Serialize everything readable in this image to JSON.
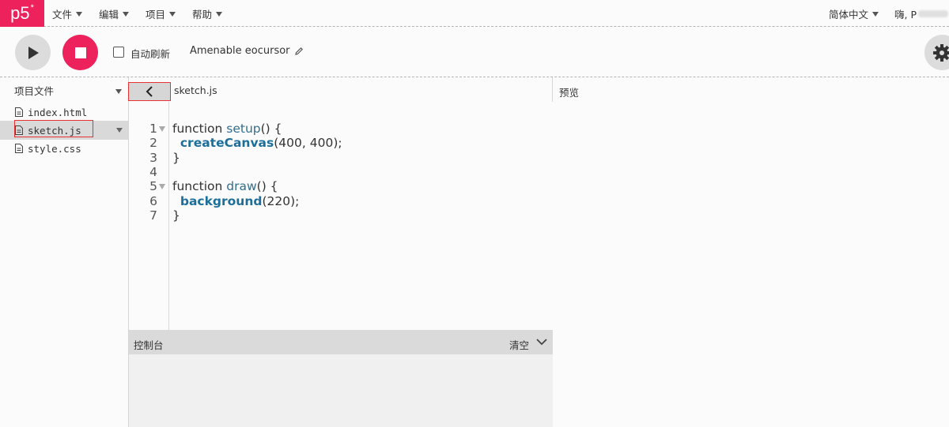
{
  "nav": {
    "logo": "p5",
    "logo_mark": "*",
    "menus": [
      "文件",
      "编辑",
      "项目",
      "帮助"
    ],
    "language": "简体中文",
    "user_greeting": "嗨, P"
  },
  "toolbar": {
    "play_icon": "play-icon",
    "stop_icon": "stop-icon",
    "autorefresh_label": "自动刷新",
    "autorefresh_checked": false,
    "project_name": "Amenable eocursor",
    "settings_icon": "gear-icon"
  },
  "sidebar": {
    "title": "项目文件",
    "files": [
      {
        "name": "index.html",
        "selected": false
      },
      {
        "name": "sketch.js",
        "selected": true
      },
      {
        "name": "style.css",
        "selected": false
      }
    ]
  },
  "editor": {
    "tab_name": "sketch.js",
    "line_numbers": [
      "1",
      "2",
      "3",
      "4",
      "5",
      "6",
      "7"
    ],
    "code_lines": [
      "function setup() {",
      "  createCanvas(400, 400);",
      "}",
      "",
      "function draw() {",
      "  background(220);",
      "}"
    ]
  },
  "console": {
    "title": "控制台",
    "clear_label": "清空"
  },
  "preview": {
    "title": "预览"
  },
  "colors": {
    "accent": "#ed225d",
    "highlight_box": "#e53333",
    "function_name": "#336e8e",
    "builtin": "#1d6f9b"
  }
}
